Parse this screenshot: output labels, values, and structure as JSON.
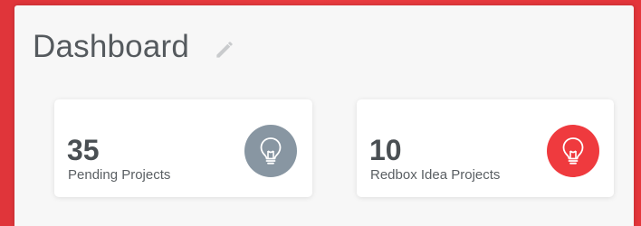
{
  "header": {
    "title": "Dashboard"
  },
  "cards": [
    {
      "count": "35",
      "label": "Pending Projects",
      "icon": "lightbulb-icon",
      "icon_color": "#8896a2"
    },
    {
      "count": "10",
      "label": "Redbox Idea Projects",
      "icon": "lightbulb-icon",
      "icon_color": "#ef3a3e"
    }
  ],
  "colors": {
    "background_red": "#e4363b",
    "panel": "#f7f7f7"
  }
}
